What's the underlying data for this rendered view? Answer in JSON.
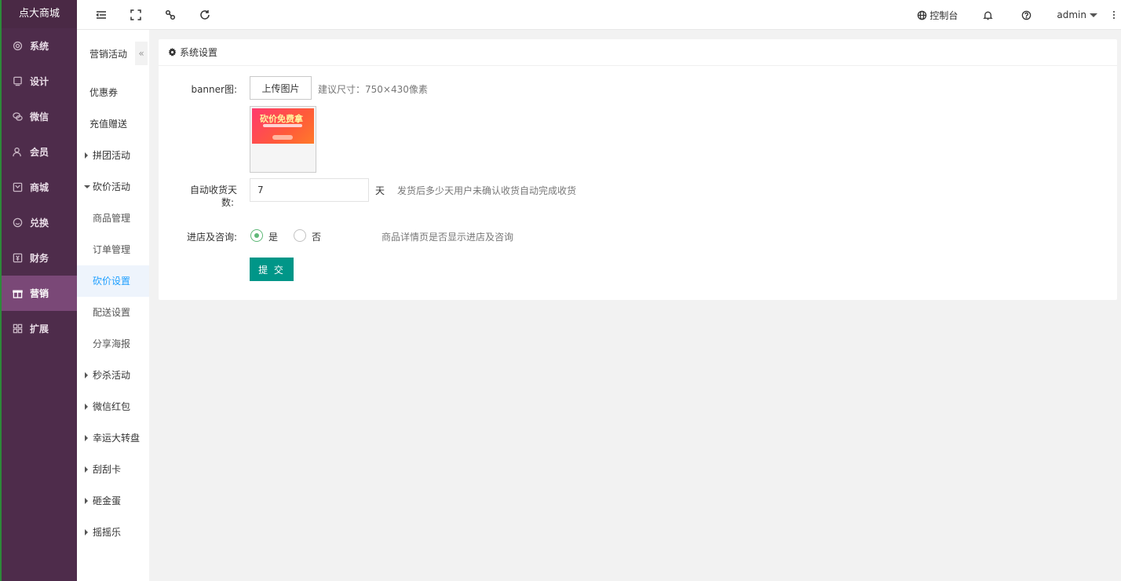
{
  "brand": "点大商城",
  "leftnav": [
    {
      "label": "系统",
      "icon": "gear-icon"
    },
    {
      "label": "设计",
      "icon": "monitor-icon"
    },
    {
      "label": "微信",
      "icon": "wechat-icon"
    },
    {
      "label": "会员",
      "icon": "user-icon"
    },
    {
      "label": "商城",
      "icon": "shop-icon"
    },
    {
      "label": "兑换",
      "icon": "exchange-icon"
    },
    {
      "label": "财务",
      "icon": "finance-icon"
    },
    {
      "label": "营销",
      "icon": "gift-icon"
    },
    {
      "label": "扩展",
      "icon": "grid-icon"
    }
  ],
  "topbar": {
    "console_label": "控制台",
    "user": "admin"
  },
  "subnav": {
    "title": "营销活动",
    "collapse_glyph": "«",
    "items": [
      "优惠券",
      "充值赠送",
      "拼团活动",
      "砍价活动",
      "商品管理",
      "订单管理",
      "砍价设置",
      "配送设置",
      "分享海报",
      "秒杀活动",
      "微信红包",
      "幸运大转盘",
      "刮刮卡",
      "砸金蛋",
      "摇摇乐"
    ]
  },
  "card": {
    "title": "系统设置",
    "banner_label": "banner图:",
    "upload_label": "上传图片",
    "upload_hint": "建议尺寸：750×430像素",
    "banner_image_text": "砍价免费拿",
    "days_label_1": "自动收货天",
    "days_label_2": "数:",
    "days_value": "7",
    "days_unit": "天",
    "days_hint": "发货后多少天用户未确认收货自动完成收货",
    "consult_label": "进店及咨询:",
    "radio_yes": "是",
    "radio_no": "否",
    "consult_hint": "商品详情页是否显示进店及咨询",
    "submit_label": "提 交"
  }
}
